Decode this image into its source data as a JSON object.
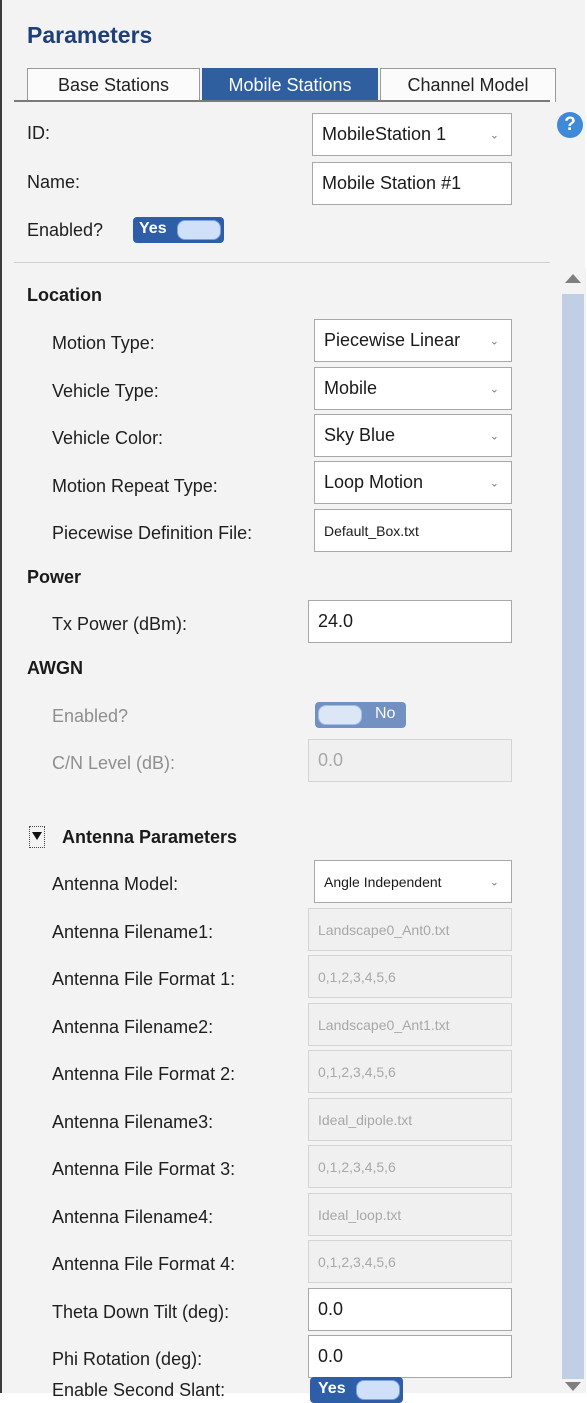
{
  "panel": {
    "title": "Parameters"
  },
  "tabs": [
    {
      "label": "Base Stations"
    },
    {
      "label": "Mobile Stations"
    },
    {
      "label": "Channel Model"
    }
  ],
  "general": {
    "id_label": "ID:",
    "id_value": "MobileStation 1",
    "name_label": "Name:",
    "name_value": "Mobile Station #1",
    "enabled_label": "Enabled?",
    "enabled_value": "Yes"
  },
  "location": {
    "header": "Location",
    "motion_type_label": "Motion Type:",
    "motion_type_value": "Piecewise Linear",
    "vehicle_type_label": "Vehicle Type:",
    "vehicle_type_value": "Mobile",
    "vehicle_color_label": "Vehicle Color:",
    "vehicle_color_value": "Sky Blue",
    "motion_repeat_label": "Motion Repeat Type:",
    "motion_repeat_value": "Loop Motion",
    "piecewise_file_label": "Piecewise Definition File:",
    "piecewise_file_value": "Default_Box.txt"
  },
  "power": {
    "header": "Power",
    "tx_power_label": "Tx Power (dBm):",
    "tx_power_value": "24.0"
  },
  "awgn": {
    "header": "AWGN",
    "enabled_label": "Enabled?",
    "enabled_value": "No",
    "cn_label": "C/N Level (dB):",
    "cn_value": "0.0"
  },
  "antenna": {
    "header": "Antenna Parameters",
    "model_label": "Antenna Model:",
    "model_value": "Angle Independent",
    "filename1_label": "Antenna Filename1:",
    "filename1_value": "Landscape0_Ant0.txt",
    "format1_label": "Antenna File Format 1:",
    "format1_value": "0,1,2,3,4,5,6",
    "filename2_label": "Antenna Filename2:",
    "filename2_value": "Landscape0_Ant1.txt",
    "format2_label": "Antenna File Format 2:",
    "format2_value": "0,1,2,3,4,5,6",
    "filename3_label": "Antenna Filename3:",
    "filename3_value": "Ideal_dipole.txt",
    "format3_label": "Antenna File Format 3:",
    "format3_value": "0,1,2,3,4,5,6",
    "filename4_label": "Antenna Filename4:",
    "filename4_value": "Ideal_loop.txt",
    "format4_label": "Antenna File Format 4:",
    "format4_value": "0,1,2,3,4,5,6",
    "theta_label": "Theta Down Tilt (deg):",
    "theta_value": "0.0",
    "phi_label": "Phi Rotation (deg):",
    "phi_value": "0.0",
    "second_slant_label": "Enable Second Slant:",
    "second_slant_value": "Yes"
  },
  "help": {
    "glyph": "?"
  },
  "colors": {
    "accent": "#2f5f9f",
    "title": "#1f3f7a",
    "help": "#3f8ad8"
  }
}
